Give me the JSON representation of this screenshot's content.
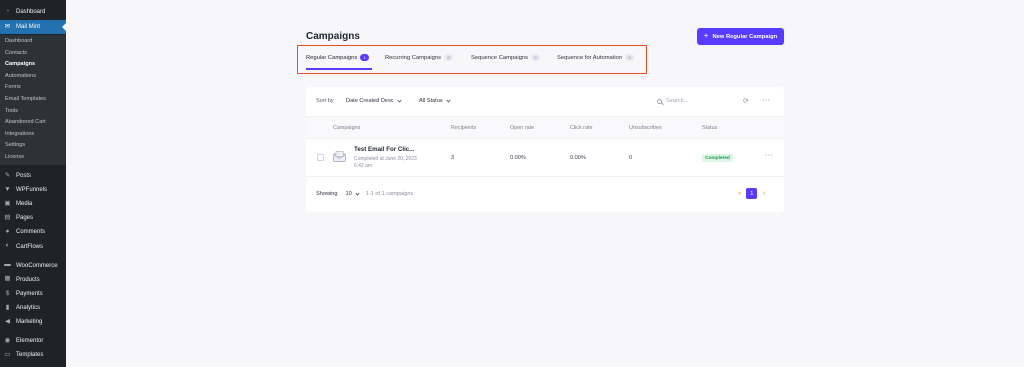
{
  "sidebar": {
    "top": {
      "label": "Dashboard",
      "icon": "dashboard-icon"
    },
    "active": {
      "label": "Mail Mint",
      "icon": "mail-icon"
    },
    "submenu": [
      {
        "label": "Dashboard"
      },
      {
        "label": "Contacts"
      },
      {
        "label": "Campaigns"
      },
      {
        "label": "Automations"
      },
      {
        "label": "Forms"
      },
      {
        "label": "Email Templates"
      },
      {
        "label": "Tools"
      },
      {
        "label": "Abandoned Cart"
      },
      {
        "label": "Integrations"
      },
      {
        "label": "Settings"
      },
      {
        "label": "License"
      }
    ],
    "group1": [
      {
        "label": "Posts",
        "icon": "pin-icon"
      },
      {
        "label": "WPFunnels",
        "icon": "funnel-icon"
      },
      {
        "label": "Media",
        "icon": "media-icon"
      },
      {
        "label": "Pages",
        "icon": "pages-icon"
      },
      {
        "label": "Comments",
        "icon": "comment-icon"
      },
      {
        "label": "CartFlows",
        "icon": "cartflows-icon"
      }
    ],
    "group2": [
      {
        "label": "WooCommerce",
        "icon": "woocommerce-icon"
      },
      {
        "label": "Products",
        "icon": "products-icon"
      },
      {
        "label": "Payments",
        "icon": "payments-icon"
      },
      {
        "label": "Analytics",
        "icon": "analytics-icon"
      },
      {
        "label": "Marketing",
        "icon": "megaphone-icon"
      }
    ],
    "group3": [
      {
        "label": "Elementor",
        "icon": "elementor-icon"
      },
      {
        "label": "Templates",
        "icon": "templates-icon"
      }
    ]
  },
  "page": {
    "title": "Campaigns",
    "new_button": "New Regular Campaign"
  },
  "tabs": [
    {
      "label": "Regular Campaigns",
      "count": "1"
    },
    {
      "label": "Recurring Campaigns",
      "count": "0"
    },
    {
      "label": "Sequence Campaigns",
      "count": "0"
    },
    {
      "label": "Sequence for Automation",
      "count": "0"
    }
  ],
  "filters": {
    "sort_by": "Sort by",
    "sort_value": "Date Created Desc",
    "status_value": "All Status",
    "search_placeholder": "Search..."
  },
  "table": {
    "headers": [
      "Campaigns",
      "Recipients",
      "Open rate",
      "Click rate",
      "Unsubscribes",
      "Status"
    ],
    "rows": [
      {
        "title": "Test Email For Clic...",
        "subtitle": "Completed at June 20, 2023 6:42 am",
        "recipients": "3",
        "open_rate": "0.00%",
        "click_rate": "0.00%",
        "unsubscribes": "0",
        "status": "Completed"
      }
    ]
  },
  "footer": {
    "showing": "Showing",
    "per_page": "10",
    "range": "1-1 of 1 campaigns",
    "current_page": "1"
  },
  "colors": {
    "accent": "#573bff",
    "highlight_box": "#e5502b",
    "wp_sidebar": "#1d2327",
    "wp_active": "#2271b1",
    "status_completed": "#17a34a"
  }
}
